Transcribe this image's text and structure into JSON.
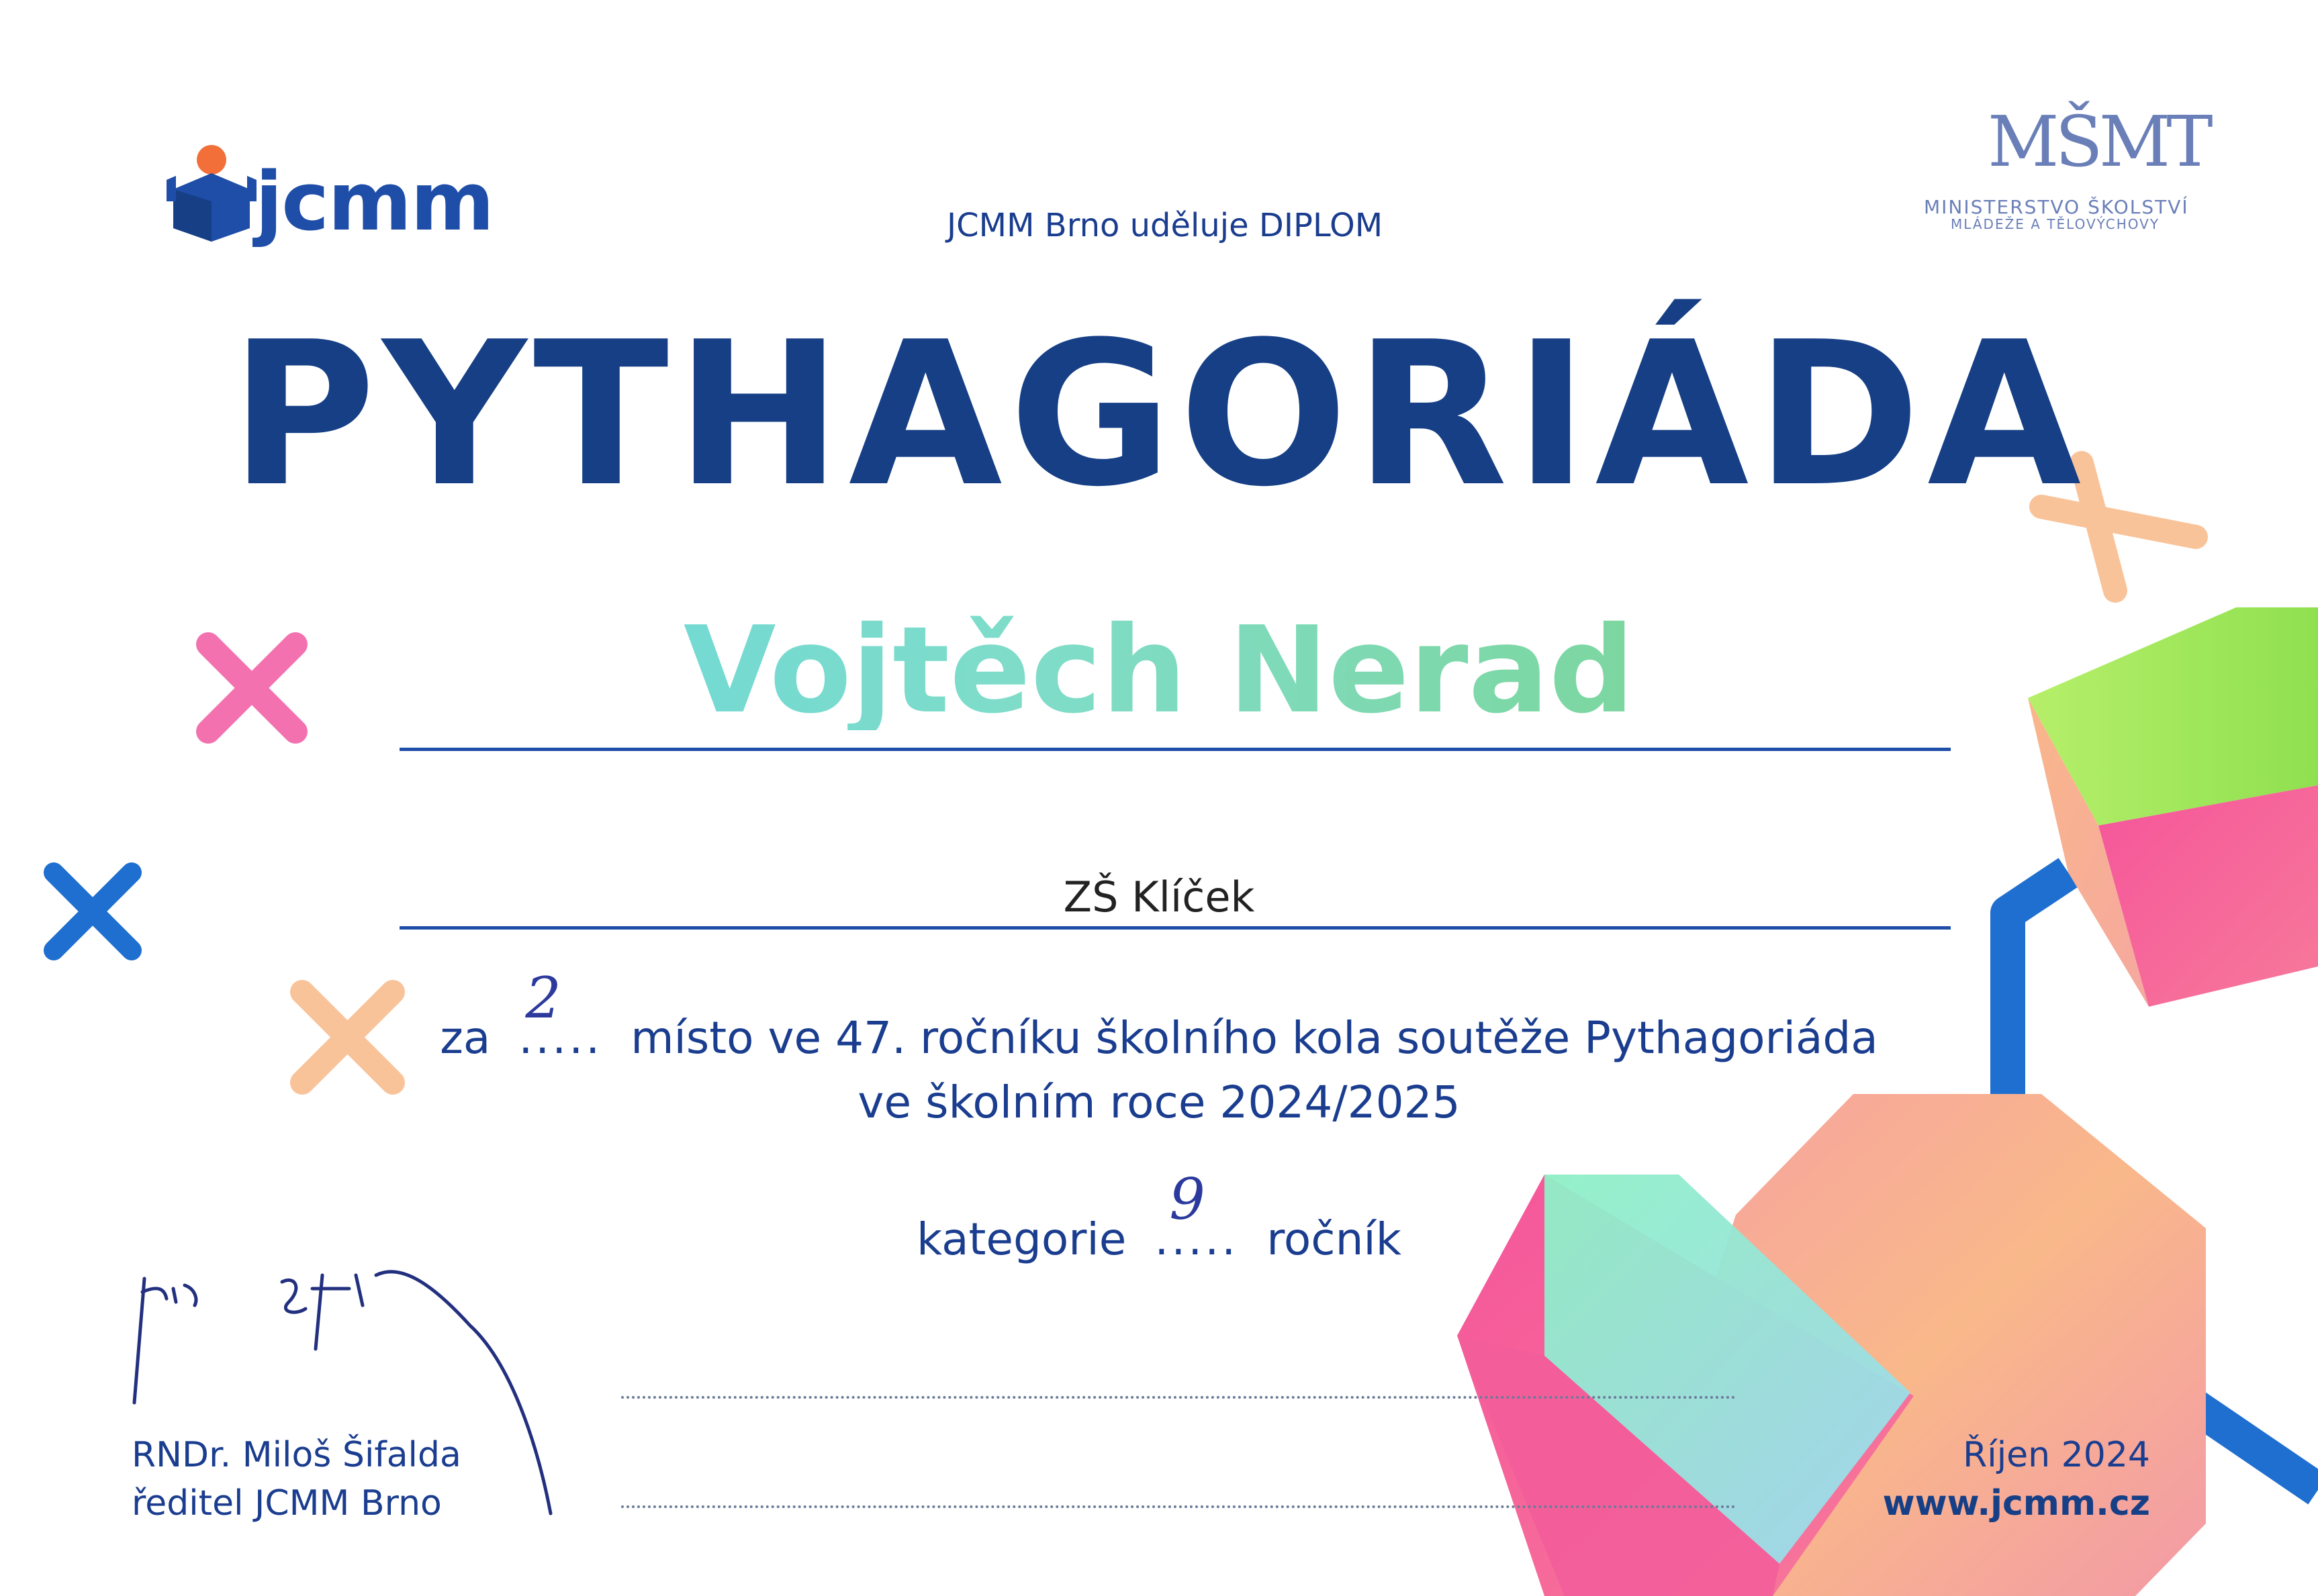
{
  "header": {
    "logo_text": "jcmm",
    "issuer_line": "JCMM Brno uděluje DIPLOM",
    "ministry_mark": "MŠMT",
    "ministry_line1": "MINISTERSTVO ŠKOLSTVÍ",
    "ministry_line2": "MLÁDEŽE A TĚLOVÝCHOVY"
  },
  "diploma": {
    "title": "PYTHAGORIÁDA",
    "recipient": "Vojtěch Nerad",
    "school": "ZŠ Klíček",
    "line1_prefix": "za",
    "place_handwritten": "2",
    "place_dots": ".....",
    "line1_suffix": "místo ve 47. ročníku školního kola soutěže Pythagoriáda",
    "line2": "ve školním roce 2024/2025",
    "category_prefix": "kategorie",
    "category_handwritten": "9",
    "category_dots": ".....",
    "category_suffix": "ročník"
  },
  "footer": {
    "signatory_name": "RNDr. Miloš Šifalda",
    "signatory_role": "ředitel JCMM Brno",
    "date": "Říjen 2024",
    "website": "www.jcmm.cz"
  },
  "colors": {
    "primary_blue": "#163f86",
    "accent_blue": "#1f6fd0",
    "pink": "#f06aa8",
    "peach": "#f8bb8a",
    "green": "#a8e84a",
    "cyan": "#7fe0d8"
  }
}
